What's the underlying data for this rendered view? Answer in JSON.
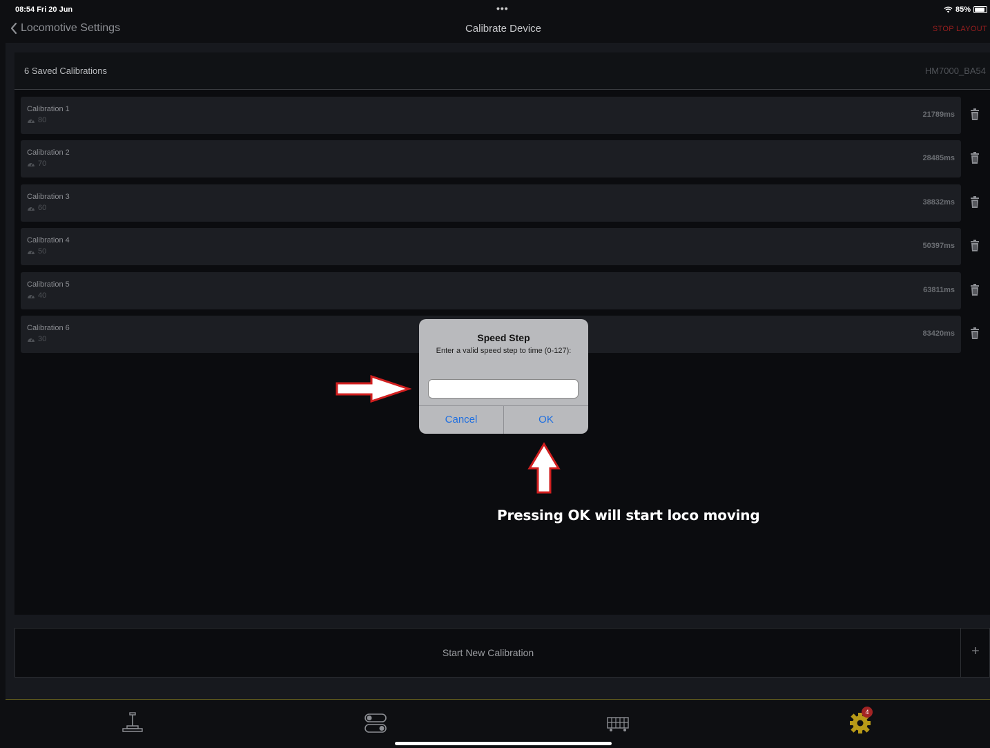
{
  "status_bar": {
    "time": "08:54  Fri 20 Jun",
    "multitask": "•••",
    "battery": "85%"
  },
  "nav": {
    "back_label": "Locomotive Settings",
    "title": "Calibrate Device",
    "stop_label": "STOP LAYOUT"
  },
  "calibrations": {
    "count_label": "6 Saved Calibrations",
    "device": "HM7000_BA54",
    "items": [
      {
        "name": "Calibration 1",
        "speed": "80",
        "time": "21789ms"
      },
      {
        "name": "Calibration 2",
        "speed": "70",
        "time": "28485ms"
      },
      {
        "name": "Calibration 3",
        "speed": "60",
        "time": "38832ms"
      },
      {
        "name": "Calibration 4",
        "speed": "50",
        "time": "50397ms"
      },
      {
        "name": "Calibration 5",
        "speed": "40",
        "time": "63811ms"
      },
      {
        "name": "Calibration 6",
        "speed": "30",
        "time": "83420ms"
      }
    ]
  },
  "dialog": {
    "title": "Speed Step",
    "message": "Enter a valid speed step to time (0-127):",
    "input_value": "",
    "cancel_label": "Cancel",
    "ok_label": "OK"
  },
  "annotation": {
    "text": "Pressing OK will start loco moving",
    "arrow_color": "#d11f1f"
  },
  "start_calibration": {
    "label": "Start New Calibration",
    "plus": "+"
  },
  "tabbar": {
    "tabs": [
      {
        "icon": "throttle-icon"
      },
      {
        "icon": "toggles-icon"
      },
      {
        "icon": "locomotive-icon"
      },
      {
        "icon": "gear-icon",
        "badge": "4"
      }
    ]
  },
  "colors": {
    "background": "#0e0f12",
    "stop": "#9a1f1f",
    "dialog_button": "#1f6fe0",
    "gear": "#b89a18"
  }
}
